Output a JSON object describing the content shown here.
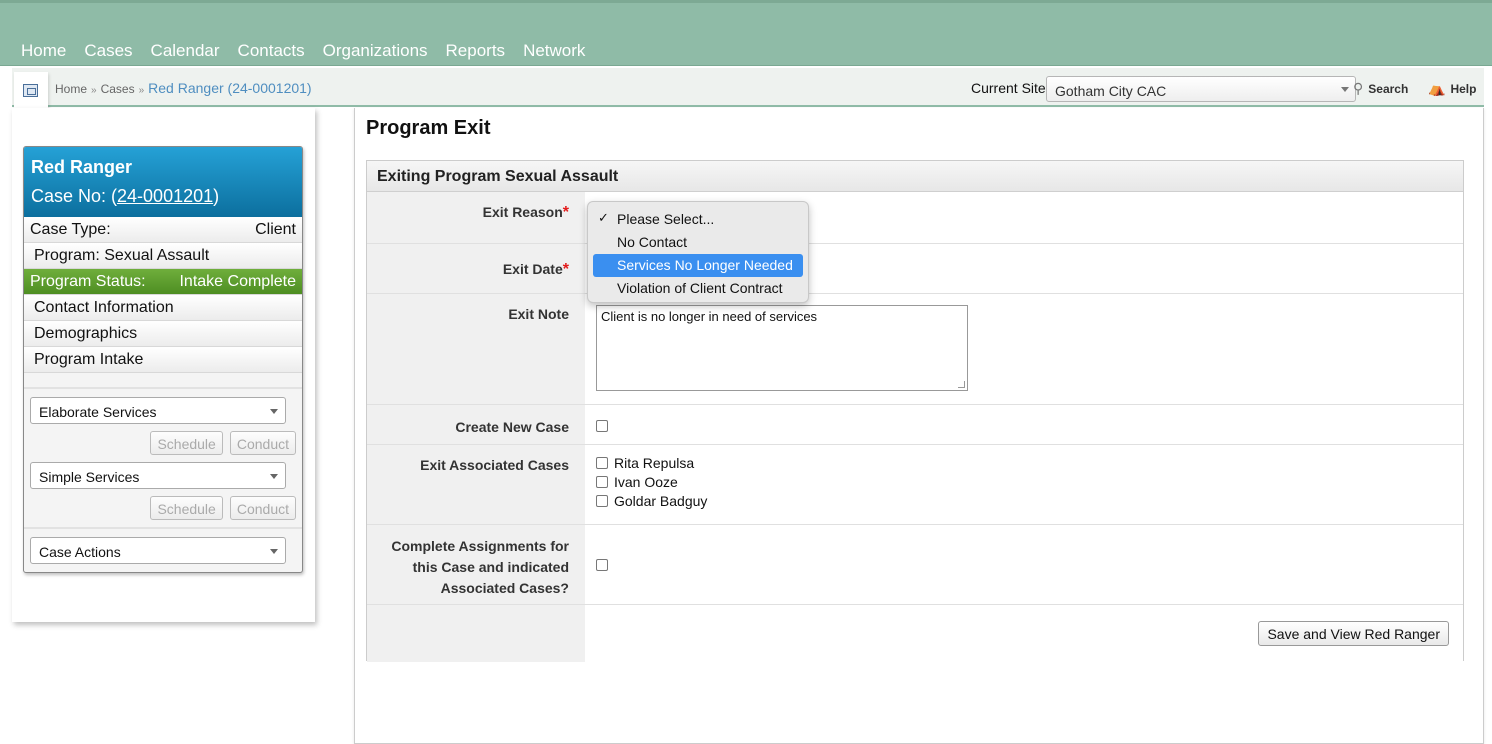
{
  "nav": [
    "Home",
    "Cases",
    "Calendar",
    "Contacts",
    "Organizations",
    "Reports",
    "Network"
  ],
  "breadcrumb": {
    "items": [
      "Home",
      "Cases"
    ],
    "current": "Red Ranger (24-0001201)"
  },
  "site": {
    "label": "Current Site",
    "value": "Gotham City CAC"
  },
  "tools": {
    "search": "Search",
    "help": "Help"
  },
  "case": {
    "name": "Red Ranger",
    "case_no_prefix": "Case No: (",
    "case_no": "24-0001201",
    "case_no_suffix": ")",
    "case_type_label": "Case Type:",
    "case_type": "Client",
    "program": "Program: Sexual Assault",
    "status_label": "Program Status:",
    "status": "Intake Complete",
    "links": [
      "Contact Information",
      "Demographics",
      "Program Intake"
    ]
  },
  "sidebar_actions": {
    "elaborate": "Elaborate Services",
    "simple": "Simple Services",
    "schedule": "Schedule",
    "conduct": "Conduct",
    "case_actions": "Case Actions"
  },
  "page": {
    "title": "Program Exit",
    "section": "Exiting Program Sexual Assault"
  },
  "form": {
    "exit_reason": "Exit Reason",
    "exit_date": "Exit Date",
    "exit_note": "Exit Note",
    "exit_note_value": "Client is no longer in need of services",
    "create_new_case": "Create New Case",
    "exit_associated": "Exit Associated Cases",
    "associated_cases": [
      "Rita Repulsa",
      "Ivan Ooze",
      "Goldar Badguy"
    ],
    "complete_assign": "Complete Assignments for this Case and indicated Associated Cases?",
    "save": "Save and View Red Ranger"
  },
  "dropdown": {
    "options": [
      "Please Select...",
      "No Contact",
      "Services No Longer Needed",
      "Violation of Client Contract"
    ],
    "checked_index": 0,
    "highlighted_index": 2
  }
}
